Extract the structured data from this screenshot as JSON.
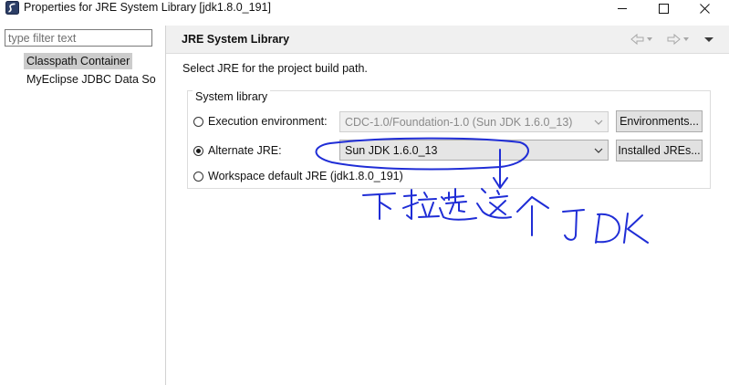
{
  "window": {
    "title": "Properties for JRE System Library [jdk1.8.0_191]",
    "controls": [
      "minimize",
      "maximize",
      "close"
    ]
  },
  "sidebar": {
    "filter_placeholder": "type filter text",
    "items": [
      {
        "label": "Classpath Container",
        "selected": true
      },
      {
        "label": "MyEclipse JDBC Data So",
        "selected": false
      }
    ]
  },
  "page": {
    "title": "JRE System Library",
    "description": "Select JRE for the project build path.",
    "nav_icons": [
      "back-arrow-icon",
      "forward-arrow-icon",
      "view-menu-icon"
    ]
  },
  "system_library": {
    "group_label": "System library",
    "execution_environment": {
      "label": "Execution environment:",
      "value": "CDC-1.0/Foundation-1.0 (Sun JDK 1.6.0_13)",
      "enabled": false,
      "selected": false,
      "button": "Environments..."
    },
    "alternate_jre": {
      "label": "Alternate JRE:",
      "value": "Sun JDK 1.6.0_13",
      "selected": true,
      "button": "Installed JREs..."
    },
    "workspace_default": {
      "label": "Workspace default JRE (jdk1.8.0_191)",
      "selected": false
    }
  },
  "annotation": {
    "handwritten_text": "下拉选这个JDK",
    "color": "#1f2dd6"
  },
  "colors": {
    "header_bg": "#f0f0f0",
    "selection_bg": "#cccccc",
    "button_bg": "#e1e1e1"
  }
}
